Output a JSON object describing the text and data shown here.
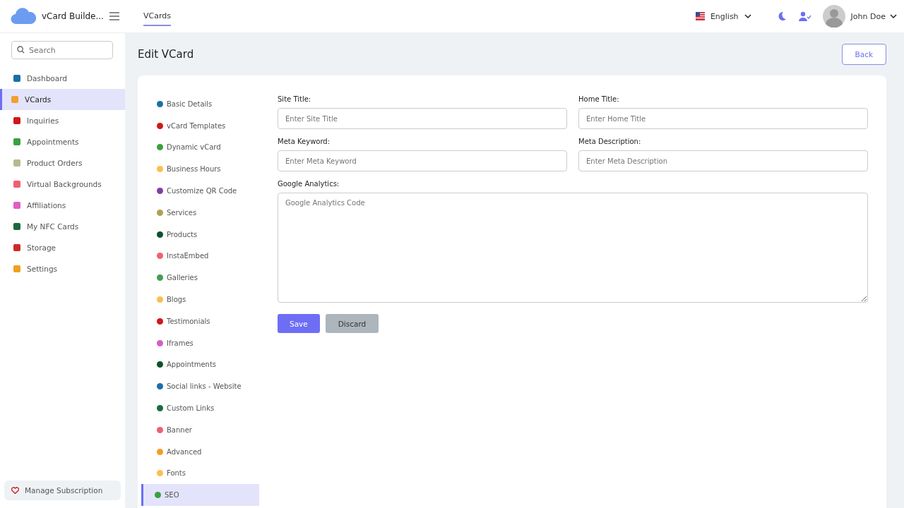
{
  "header": {
    "brand": "vCard Builde...",
    "nav_tabs": [
      {
        "label": "VCards",
        "selected": true
      }
    ],
    "language": "English",
    "user": "John Doe"
  },
  "sidebar": {
    "search": {
      "placeholder": "Search"
    },
    "items": [
      {
        "label": "Dashboard",
        "selected": false,
        "color": "#1a6fa8"
      },
      {
        "label": "VCards",
        "selected": true,
        "color": "#f0a030"
      },
      {
        "label": "Inquiries",
        "selected": false,
        "color": "#d01818"
      },
      {
        "label": "Appointments",
        "selected": false,
        "color": "#3aa040"
      },
      {
        "label": "Product Orders",
        "selected": false,
        "color": "#b8b890"
      },
      {
        "label": "Virtual Backgrounds",
        "selected": false,
        "color": "#f06070"
      },
      {
        "label": "Affiliations",
        "selected": false,
        "color": "#e060c0"
      },
      {
        "label": "My NFC Cards",
        "selected": false,
        "color": "#1a6a40"
      },
      {
        "label": "Storage",
        "selected": false,
        "color": "#d02828"
      },
      {
        "label": "Settings",
        "selected": false,
        "color": "#f0a020"
      }
    ],
    "footer": "Manage Subscription"
  },
  "page": {
    "title": "Edit VCard",
    "back": "Back"
  },
  "sections": [
    {
      "label": "Basic Details",
      "selected": false,
      "color": "#1a6fa8"
    },
    {
      "label": "vCard Templates",
      "selected": false,
      "color": "#d01818"
    },
    {
      "label": "Dynamic vCard",
      "selected": false,
      "color": "#3aa040"
    },
    {
      "label": "Business Hours",
      "selected": false,
      "color": "#f8c050"
    },
    {
      "label": "Customize QR Code",
      "selected": false,
      "color": "#8040a0"
    },
    {
      "label": "Services",
      "selected": false,
      "color": "#b0a050"
    },
    {
      "label": "Products",
      "selected": false,
      "color": "#10502a"
    },
    {
      "label": "InstaEmbed",
      "selected": false,
      "color": "#f06070"
    },
    {
      "label": "Galleries",
      "selected": false,
      "color": "#40a050"
    },
    {
      "label": "Blogs",
      "selected": false,
      "color": "#f8c050"
    },
    {
      "label": "Testimonials",
      "selected": false,
      "color": "#d01818"
    },
    {
      "label": "Iframes",
      "selected": false,
      "color": "#d060c0"
    },
    {
      "label": "Appointments",
      "selected": false,
      "color": "#10502a"
    },
    {
      "label": "Social links - Website",
      "selected": false,
      "color": "#1a6fa8"
    },
    {
      "label": "Custom Links",
      "selected": false,
      "color": "#1a6a40"
    },
    {
      "label": "Banner",
      "selected": false,
      "color": "#f06070"
    },
    {
      "label": "Advanced",
      "selected": false,
      "color": "#f0a020"
    },
    {
      "label": "Fonts",
      "selected": false,
      "color": "#f8c050"
    },
    {
      "label": "SEO",
      "selected": true,
      "color": "#3aa040"
    }
  ],
  "form": {
    "fields": [
      {
        "label": "Site Title:",
        "placeholder": "Enter Site Title",
        "kind": "input"
      },
      {
        "label": "Home Title:",
        "placeholder": "Enter Home Title",
        "kind": "input"
      },
      {
        "label": "Meta Keyword:",
        "placeholder": "Enter Meta Keyword",
        "kind": "input"
      },
      {
        "label": "Meta Description:",
        "placeholder": "Enter Meta Description",
        "kind": "input"
      },
      {
        "label": "Google Analytics:",
        "placeholder": "Google Analytics Code",
        "kind": "textarea"
      }
    ],
    "buttons": [
      {
        "label": "Save",
        "kind": "primary"
      },
      {
        "label": "Discard",
        "kind": "secondary"
      }
    ]
  }
}
